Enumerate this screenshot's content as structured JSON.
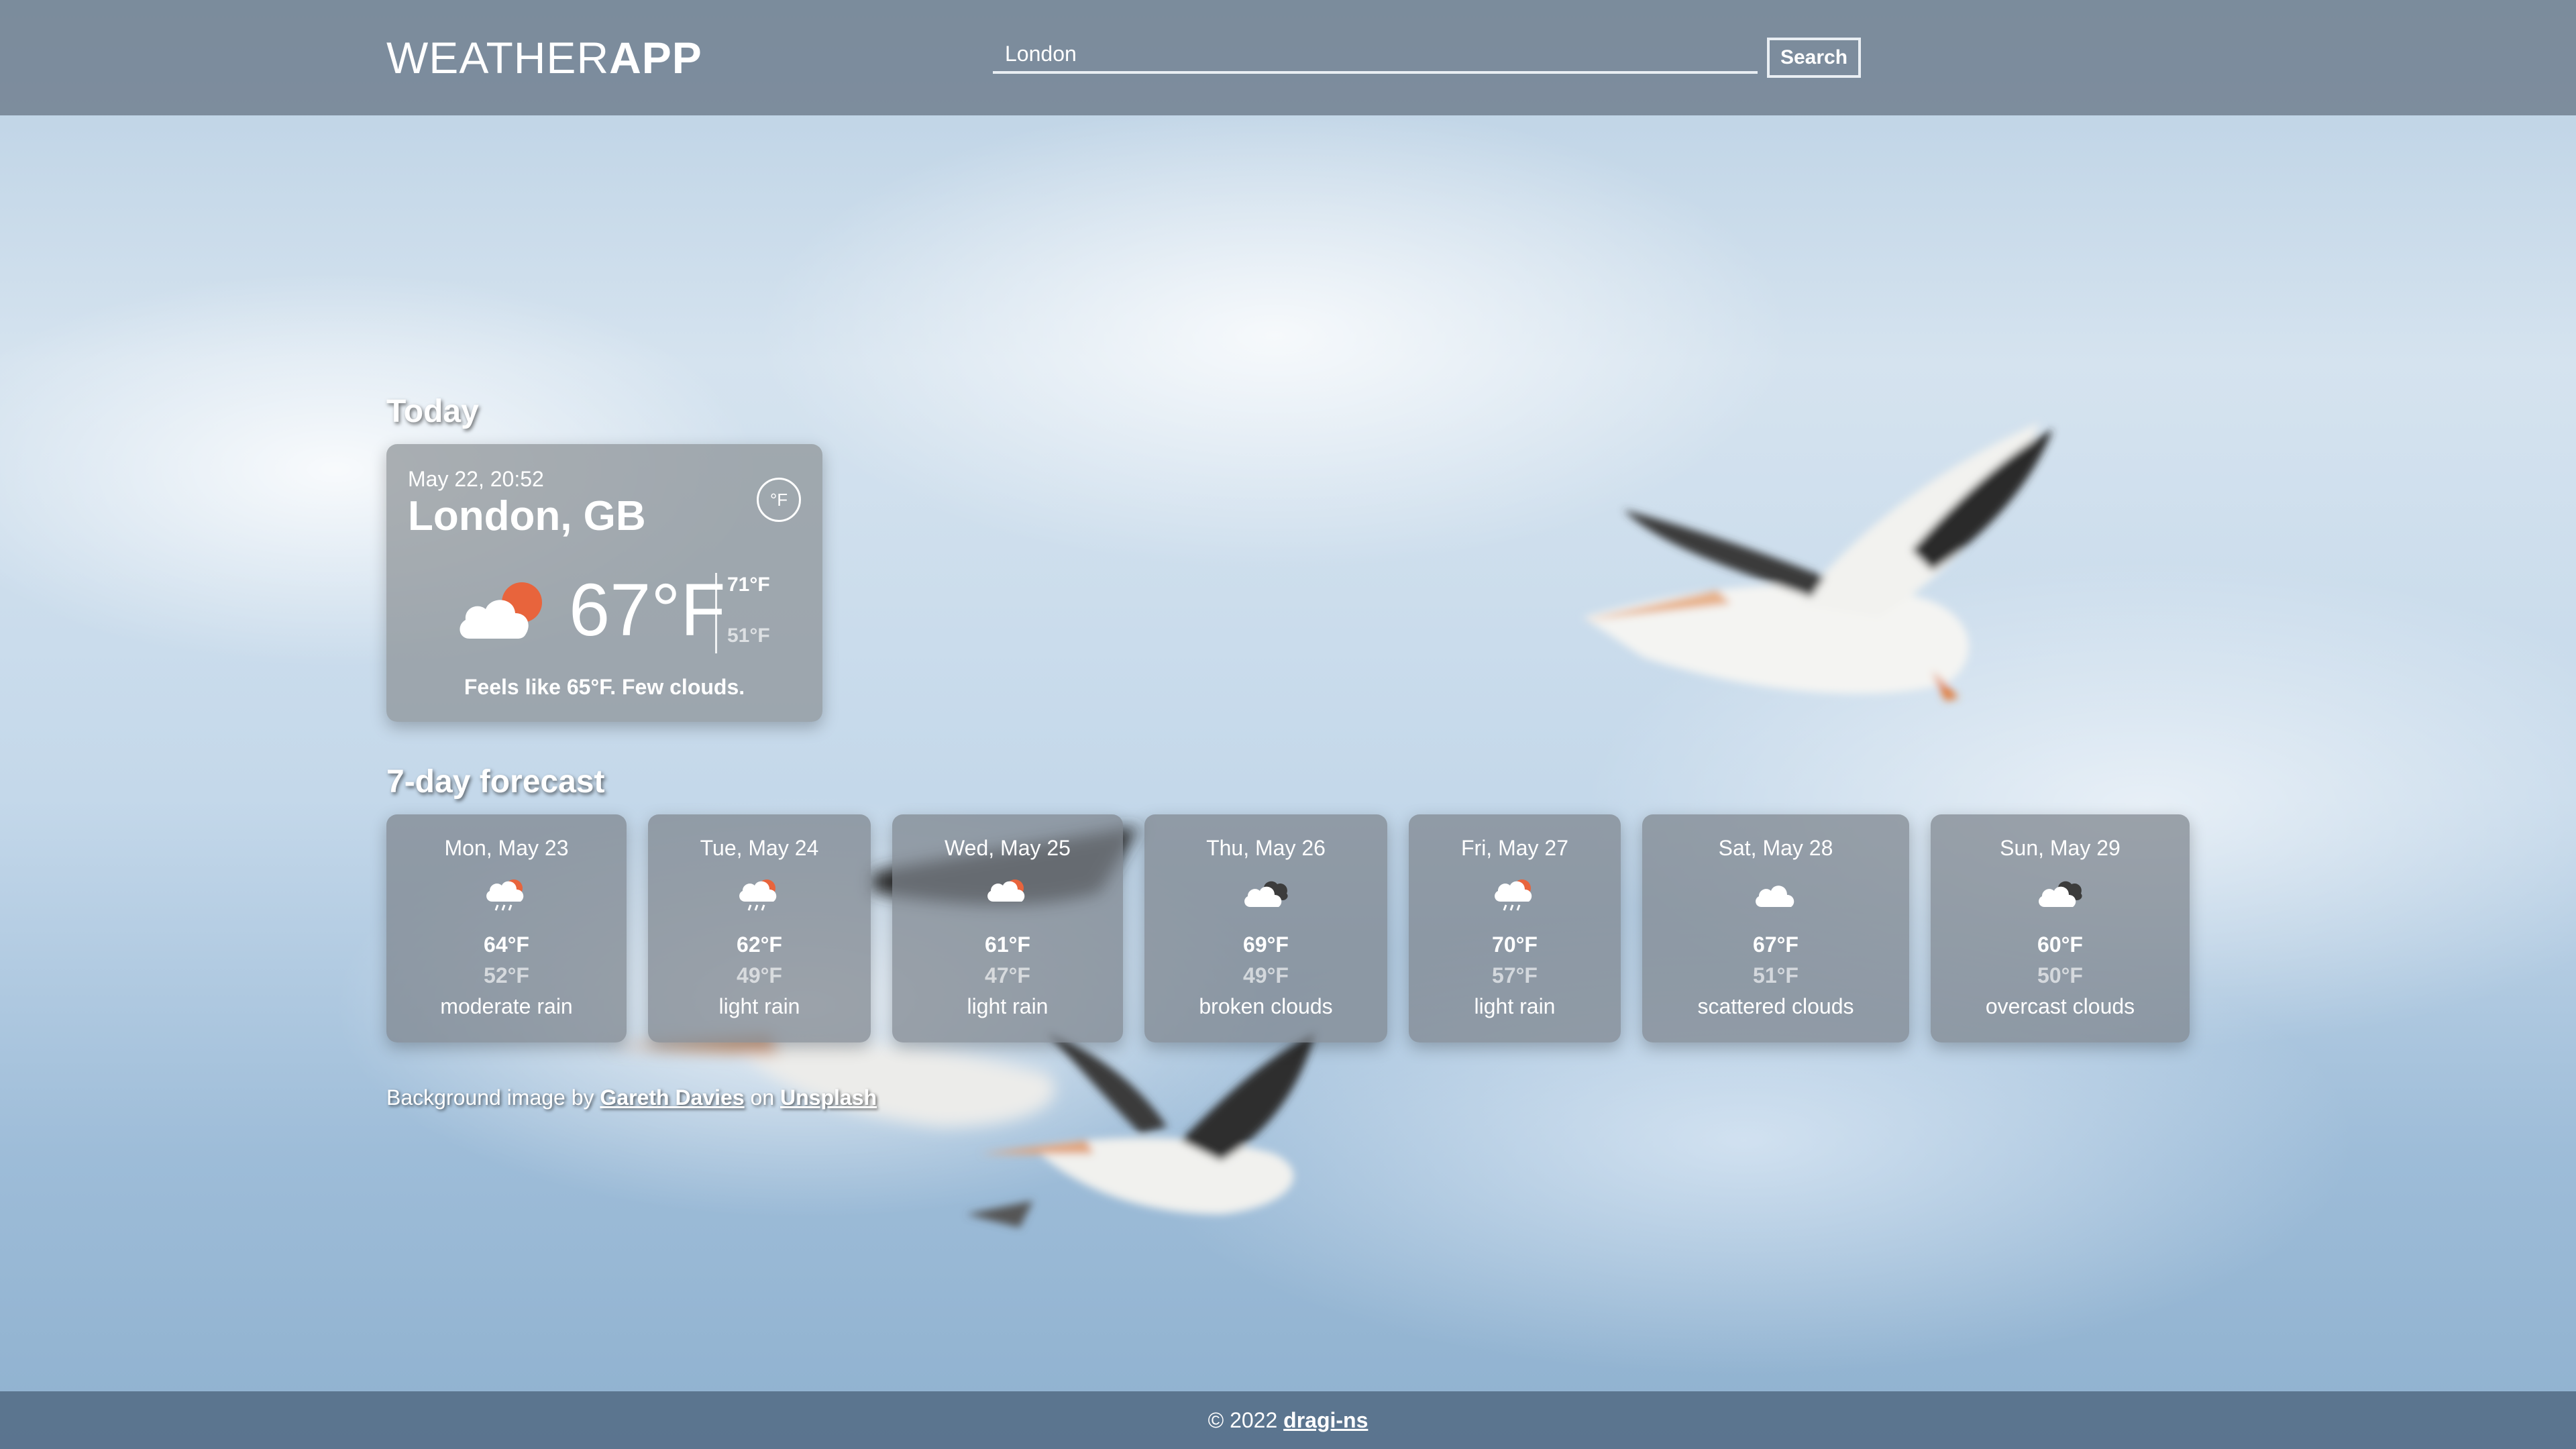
{
  "header": {
    "logo_light": "WEATHER",
    "logo_bold": "APP",
    "search_value": "London",
    "search_button": "Search"
  },
  "today": {
    "title": "Today",
    "datetime": "May 22, 20:52",
    "city": "London, GB",
    "unit_toggle": "°F",
    "temp": "67°F",
    "high": "71°F",
    "low": "51°F",
    "description": "Feels like 65°F. Few clouds.",
    "icon": "few-clouds-night-icon"
  },
  "forecast": {
    "title": "7-day forecast",
    "days": [
      {
        "date": "Mon, May 23",
        "high": "64°F",
        "low": "52°F",
        "desc": "moderate rain",
        "icon": "rain-icon"
      },
      {
        "date": "Tue, May 24",
        "high": "62°F",
        "low": "49°F",
        "desc": "light rain",
        "icon": "rain-icon"
      },
      {
        "date": "Wed, May 25",
        "high": "61°F",
        "low": "47°F",
        "desc": "light rain",
        "icon": "rain-icon"
      },
      {
        "date": "Thu, May 26",
        "high": "69°F",
        "low": "49°F",
        "desc": "broken clouds",
        "icon": "broken-clouds-icon"
      },
      {
        "date": "Fri, May 27",
        "high": "70°F",
        "low": "57°F",
        "desc": "light rain",
        "icon": "rain-icon"
      },
      {
        "date": "Sat, May 28",
        "high": "67°F",
        "low": "51°F",
        "desc": "scattered clouds",
        "icon": "cloud-icon"
      },
      {
        "date": "Sun, May 29",
        "high": "60°F",
        "low": "50°F",
        "desc": "overcast clouds",
        "icon": "broken-clouds-icon"
      }
    ]
  },
  "credit": {
    "prefix": "Background image by",
    "author": "Gareth Davies",
    "middle": "on",
    "site": "Unsplash"
  },
  "footer": {
    "copyright": "© 2022",
    "author": "dragi-ns"
  },
  "colors": {
    "sun_accent": "#e8643c",
    "header_bg": "#6e7d8c",
    "footer_bg": "#556e87"
  }
}
